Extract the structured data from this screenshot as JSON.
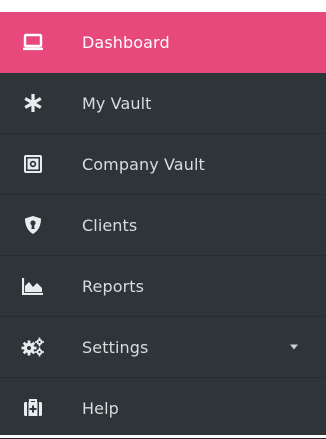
{
  "menu": {
    "items": [
      {
        "label": "Dashboard",
        "icon": "laptop-icon",
        "active": true
      },
      {
        "label": "My Vault",
        "icon": "asterisk-icon",
        "active": false
      },
      {
        "label": "Company Vault",
        "icon": "safe-icon",
        "active": false
      },
      {
        "label": "Clients",
        "icon": "shield-icon",
        "active": false
      },
      {
        "label": "Reports",
        "icon": "area-chart-icon",
        "active": false
      },
      {
        "label": "Settings",
        "icon": "cogs-icon",
        "active": false,
        "has_dropdown": true
      },
      {
        "label": "Help",
        "icon": "medkit-icon",
        "active": false
      }
    ]
  },
  "colors": {
    "sidebar_bg": "#2e3539",
    "active_bg": "#e8497c",
    "text": "#d8dcde",
    "active_text": "#ffffff"
  }
}
